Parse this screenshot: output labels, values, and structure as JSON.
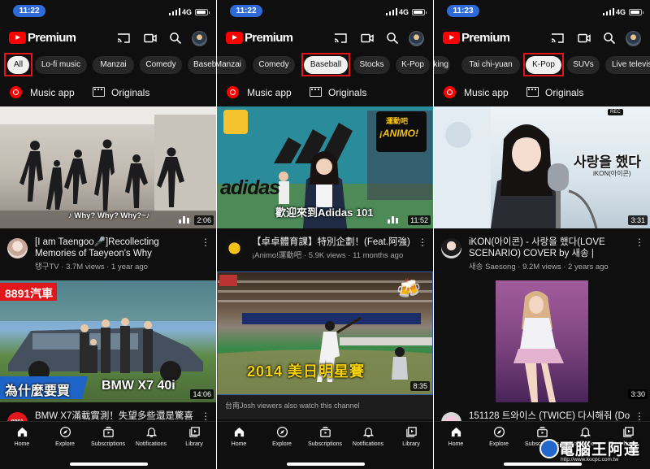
{
  "colors": {
    "accent": "#ff0000",
    "highlight": "#e3151a",
    "time_pill": "#2f6bd8",
    "background": "#0f0f0f"
  },
  "status": {
    "network": "4G"
  },
  "app": {
    "logo_text": "Premium"
  },
  "shelf": {
    "music": "Music app",
    "originals": "Originals"
  },
  "nav": [
    "Home",
    "Explore",
    "Subscriptions",
    "Notifications",
    "Library"
  ],
  "panels": [
    {
      "time": "11:22",
      "chips": [
        "All",
        "Lo-fi music",
        "Manzai",
        "Comedy",
        "Baseb"
      ],
      "selected_chip": "All",
      "videos": [
        {
          "thumb_caption": "♪ Why? Why? Why?~♪",
          "duration": "2:06",
          "title": "[I am Taengoo🎤]Recollecting Memories of Taeyeon's Why Choreogr…",
          "channel": "탱구TV",
          "views": "3.7M views",
          "age": "1 year ago"
        },
        {
          "thumb_top_label": "8891汽車",
          "thumb_caption_left": "為什麼要買",
          "thumb_caption_right": "BMW X7 40i",
          "duration": "14:06",
          "title": "BMW X7滿載實測！失望多些還是驚喜",
          "channel_badge": "8891"
        }
      ]
    },
    {
      "time": "11:22",
      "chips": [
        "Manzai",
        "Comedy",
        "Baseball",
        "Stocks",
        "K-Pop"
      ],
      "selected_chip": "Baseball",
      "videos": [
        {
          "thumb_brand": "adidas",
          "thumb_logo": "¡ANIMO!",
          "thumb_logo_top": "運動吧",
          "thumb_caption": "歡迎來到Adidas 101",
          "duration": "11:52",
          "title": "【卓卓體育課】特別企劃！(Feat.阿強)",
          "channel": "¡Animo!運動吧",
          "views": "5.9K views",
          "age": "11 months ago"
        },
        {
          "thumb_caption": "2014 美日明星賽",
          "duration": "8:35",
          "suggest": "台南Josh viewers also watch this channel"
        }
      ]
    },
    {
      "time": "11:23",
      "chips": [
        "oking",
        "Tai chi-yuan",
        "K-Pop",
        "SUVs",
        "Live televis"
      ],
      "selected_chip": "K-Pop",
      "videos": [
        {
          "thumb_caption": "사랑을 했다",
          "thumb_sub": "iKON(아이콘)",
          "thumb_badge": "REC",
          "duration": "3:31",
          "title": "iKON(아이콘) - 사랑을 했다(LOVE SCENARIO) COVER by 새송 | SAESONG",
          "channel": "새송 Saesong",
          "views": "9.2M views",
          "age": "2 years ago"
        },
        {
          "duration": "3:30",
          "title": "151128 트와이스 (TWICE) 다시해줘 (Do It"
        }
      ]
    }
  ],
  "watermark": {
    "text": "電腦王阿達",
    "url": "http://www.kocpc.com.tw"
  }
}
